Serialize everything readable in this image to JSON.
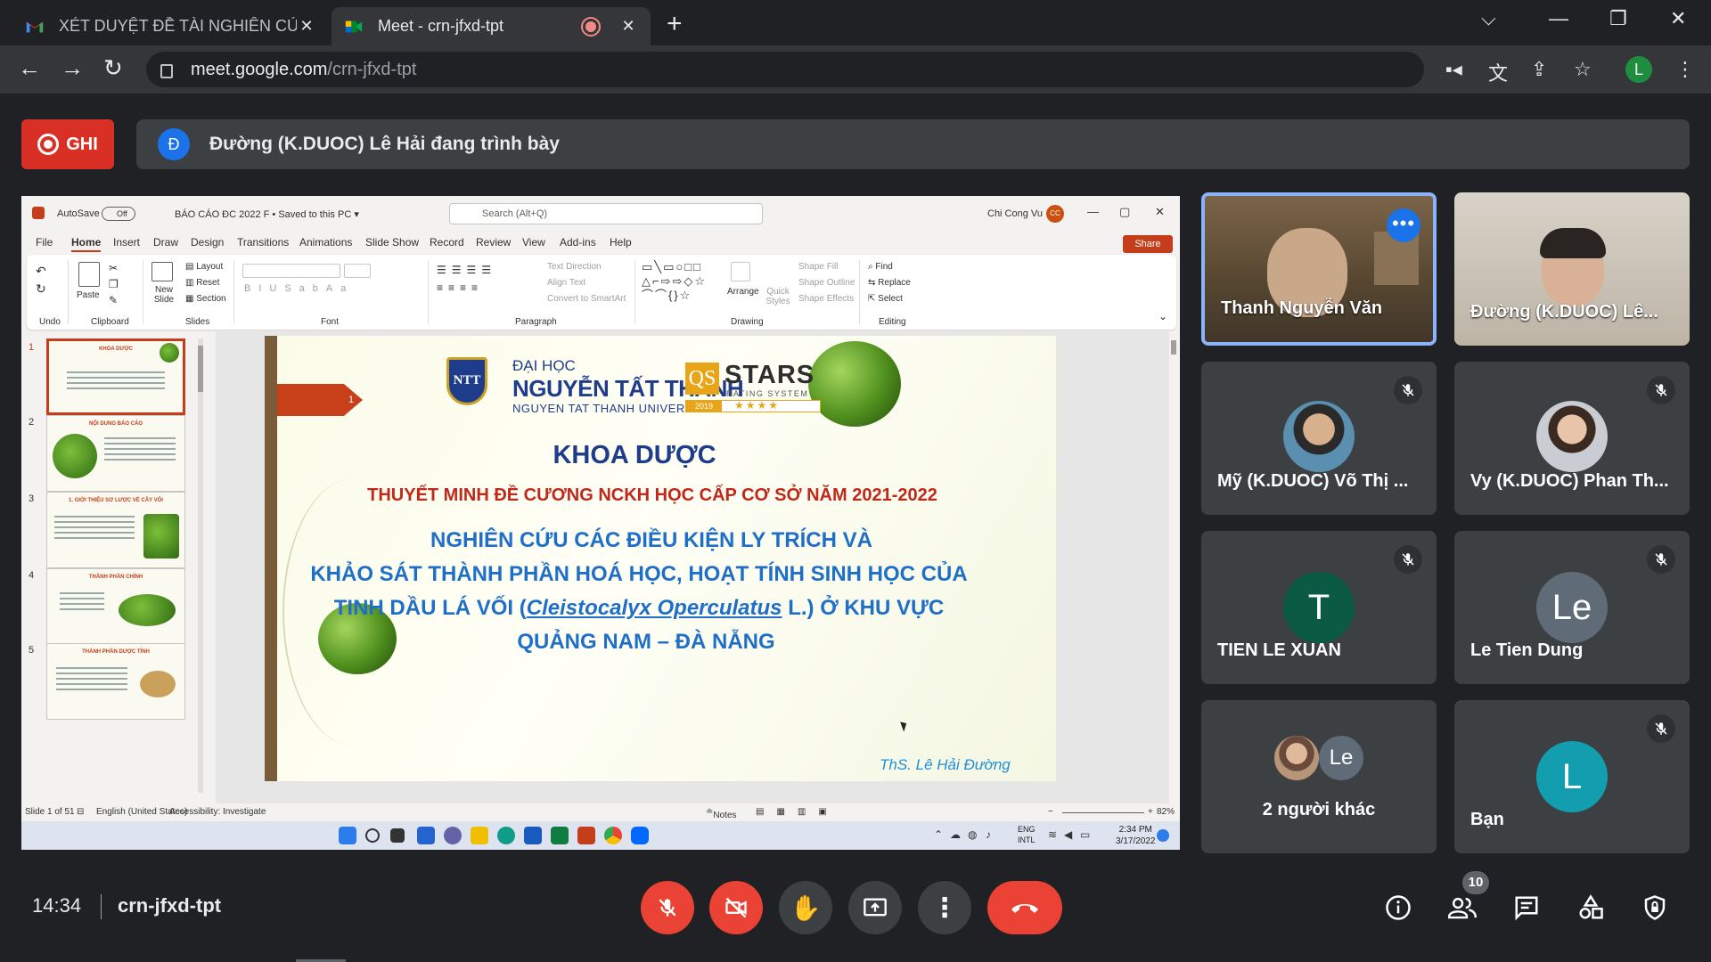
{
  "browser": {
    "tabs": [
      {
        "title": "XÉT DUYỆT ĐỀ TÀI NGHIÊN CỨU",
        "icon": "gmail-icon",
        "active": false
      },
      {
        "title": "Meet - crn-jfxd-tpt",
        "icon": "meet-icon",
        "active": true
      }
    ],
    "url_host": "meet.google.com",
    "url_path": "/crn-jfxd-tpt",
    "profile_initial": "L"
  },
  "meet": {
    "record_label": "GHI",
    "presenter_initial": "Đ",
    "presenting_text": "Đường (K.DUOC) Lê Hải đang trình bày",
    "time": "14:34",
    "meeting_code": "crn-jfxd-tpt",
    "participant_count": "10",
    "colors": {
      "record_red": "#d93025",
      "hangup_red": "#ea4335",
      "accent_blue": "#1a73e8",
      "tile_bg": "#3c4043"
    }
  },
  "participants": [
    {
      "name": "Thanh Nguyễn Văn",
      "type": "video",
      "speaking": true
    },
    {
      "name": "Đường (K.DUOC) Lê...",
      "type": "video",
      "speaking": false
    },
    {
      "name": "Mỹ (K.DUOC) Võ Thị ...",
      "type": "photo",
      "muted": true
    },
    {
      "name": "Vy (K.DUOC) Phan Th...",
      "type": "photo",
      "muted": true
    },
    {
      "name": "TIEN LE XUAN",
      "initial": "T",
      "color": "#0b5a43",
      "muted": true
    },
    {
      "name": "Le Tien Dung",
      "initial": "Le",
      "color": "#5f6c78",
      "muted": true
    },
    {
      "name": "2 người khác",
      "group_initial": "Le"
    },
    {
      "name": "Bạn",
      "initial": "L",
      "color": "#129eaf",
      "muted": true
    }
  ],
  "ppt": {
    "autosave": "AutoSave",
    "toggle": "Off",
    "doc_title": "BÁO CÁO ĐC 2022 F • Saved to this PC ▾",
    "search": "Search (Alt+Q)",
    "user": "Chi Cong Vu",
    "user_initials": "CC",
    "menu": [
      "File",
      "Home",
      "Insert",
      "Draw",
      "Design",
      "Transitions",
      "Animations",
      "Slide Show",
      "Record",
      "Review",
      "View",
      "Add-ins",
      "Help"
    ],
    "share": "Share",
    "groups": [
      "Undo",
      "Clipboard",
      "Slides",
      "Font",
      "Paragraph",
      "Drawing",
      "Editing"
    ],
    "ribbon": {
      "paste": "Paste",
      "new_slide": "New Slide",
      "layout": "Layout",
      "reset": "Reset",
      "section": "Section",
      "text_direction": "Text Direction",
      "align_text": "Align Text",
      "convert_smartart": "Convert to SmartArt",
      "arrange": "Arrange",
      "quick_styles": "Quick Styles",
      "shape_fill": "Shape Fill",
      "shape_outline": "Shape Outline",
      "shape_effects": "Shape Effects",
      "find": "Find",
      "replace": "Replace",
      "select": "Select"
    },
    "thumb_numbers": [
      "1",
      "2",
      "3",
      "4",
      "5"
    ],
    "thumb_titles": [
      "KHOA DƯỢC",
      "NỘI DUNG BÁO CÁO",
      "1. GIỚI THIỆU SƠ LƯỢC VỀ CÂY VỐI",
      "THÀNH PHẦN CHÍNH",
      "THÀNH PHẦN DƯỢC TÍNH"
    ],
    "status": {
      "slide": "Slide 1 of 51",
      "language": "English (United States)",
      "accessibility": "Accessibility: Investigate",
      "notes": "Notes",
      "zoom": "82%"
    },
    "taskbar": {
      "lang": "ENG",
      "kbd": "INTL",
      "time": "2:34 PM",
      "date": "3/17/2022"
    }
  },
  "slide": {
    "arrow_num": "1",
    "uni_line1": "ĐẠI HỌC",
    "uni_line2": "NGUYỄN TẤT THÀNH",
    "uni_line3": "NGUYEN TAT THANH UNIVERSITY",
    "logo_text": "NTT",
    "qs": "QS",
    "stars": "STARS",
    "rating": "RATING SYSTEM",
    "year": "2019",
    "stars_glyphs": "★★★★",
    "faculty": "KHOA DƯỢC",
    "subtitle": "THUYẾT MINH  ĐỀ CƯƠNG NCKH HỌC CẤP CƠ SỞ NĂM 2021-2022",
    "topic_line1": "NGHIÊN CỨU CÁC ĐIỀU KIỆN LY TRÍCH VÀ",
    "topic_line2": "KHẢO SÁT THÀNH PHẦN HOÁ HỌC, HOẠT TÍNH SINH HỌC CỦA",
    "topic_line3a": "TINH DẦU LÁ VỐI (",
    "topic_line3b": "Cleistocalyx Operculatus",
    "topic_line3c": " L.) Ở KHU VỰC",
    "topic_line4": "QUẢNG NAM – ĐÀ NẴNG",
    "author": "ThS. Lê Hải Đường"
  }
}
